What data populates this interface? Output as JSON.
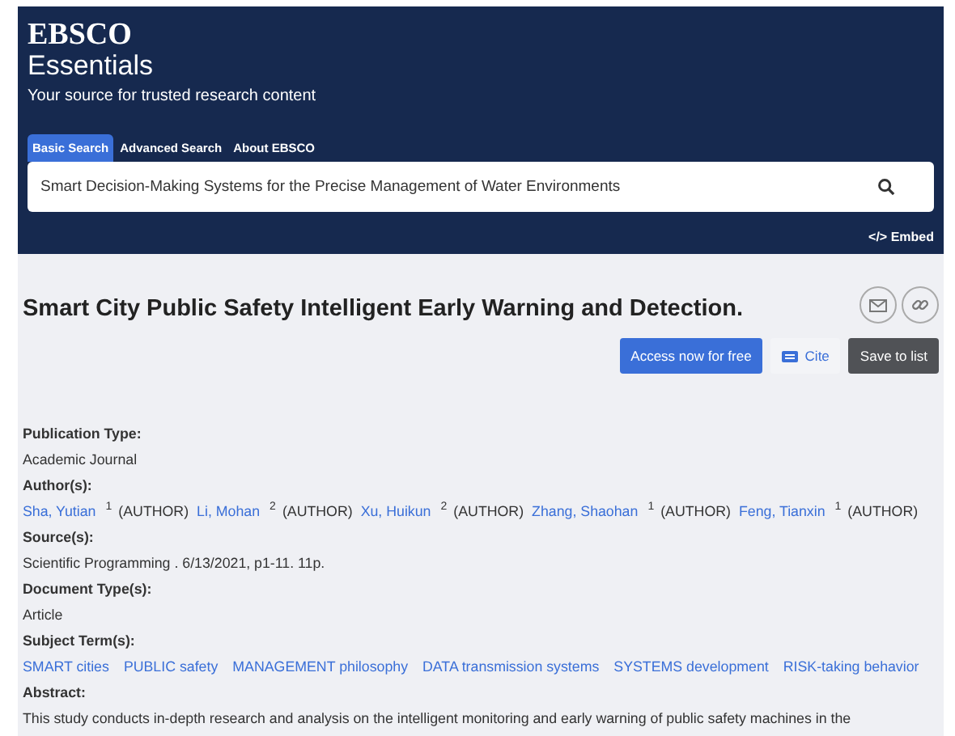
{
  "header": {
    "logo_top": "EBSCO",
    "logo_bottom": "Essentials",
    "tagline": "Your source for trusted research content",
    "tabs": [
      {
        "label": "Basic Search",
        "selected": true
      },
      {
        "label": "Advanced Search",
        "selected": false
      },
      {
        "label": "About EBSCO",
        "selected": false
      }
    ],
    "search": {
      "value": "Smart Decision-Making Systems for the Precise Management of Water Environments"
    },
    "embed": "</> Embed"
  },
  "article": {
    "title": "Smart City Public Safety Intelligent Early Warning and Detection.",
    "buttons": [
      {
        "label": "Access now for free",
        "kind": "primary"
      },
      {
        "label": "Cite",
        "kind": "cite"
      },
      {
        "label": "Save to list",
        "kind": "dark"
      }
    ],
    "fields": [
      {
        "kind": "text",
        "label": "Publication Type:",
        "value": "Academic Journal"
      },
      {
        "kind": "authors",
        "label": "Author(s):",
        "authors": [
          {
            "name": "Sha, Yutian",
            "index": "1",
            "role": "(AUTHOR)"
          },
          {
            "name": "Li, Mohan",
            "index": "2",
            "role": "(AUTHOR)"
          },
          {
            "name": "Xu, Huikun",
            "index": "2",
            "role": "(AUTHOR)"
          },
          {
            "name": "Zhang, Shaohan",
            "index": "1",
            "role": "(AUTHOR)"
          },
          {
            "name": "Feng, Tianxin",
            "index": "1",
            "role": "(AUTHOR)"
          }
        ]
      },
      {
        "kind": "text",
        "label": "Source(s):",
        "value": "Scientific Programming  . 6/13/2021, p1-11. 11p."
      },
      {
        "kind": "text",
        "label": "Document Type(s):",
        "value": "Article"
      },
      {
        "kind": "terms",
        "label": "Subject Term(s):",
        "terms": [
          "SMART cities",
          "PUBLIC safety",
          "MANAGEMENT philosophy",
          "DATA transmission systems",
          "SYSTEMS development",
          "RISK-taking behavior"
        ]
      },
      {
        "kind": "text",
        "label": "Abstract:",
        "value": "This study conducts in-depth research and analysis on the intelligent monitoring and early warning of public safety machines in the"
      }
    ]
  }
}
